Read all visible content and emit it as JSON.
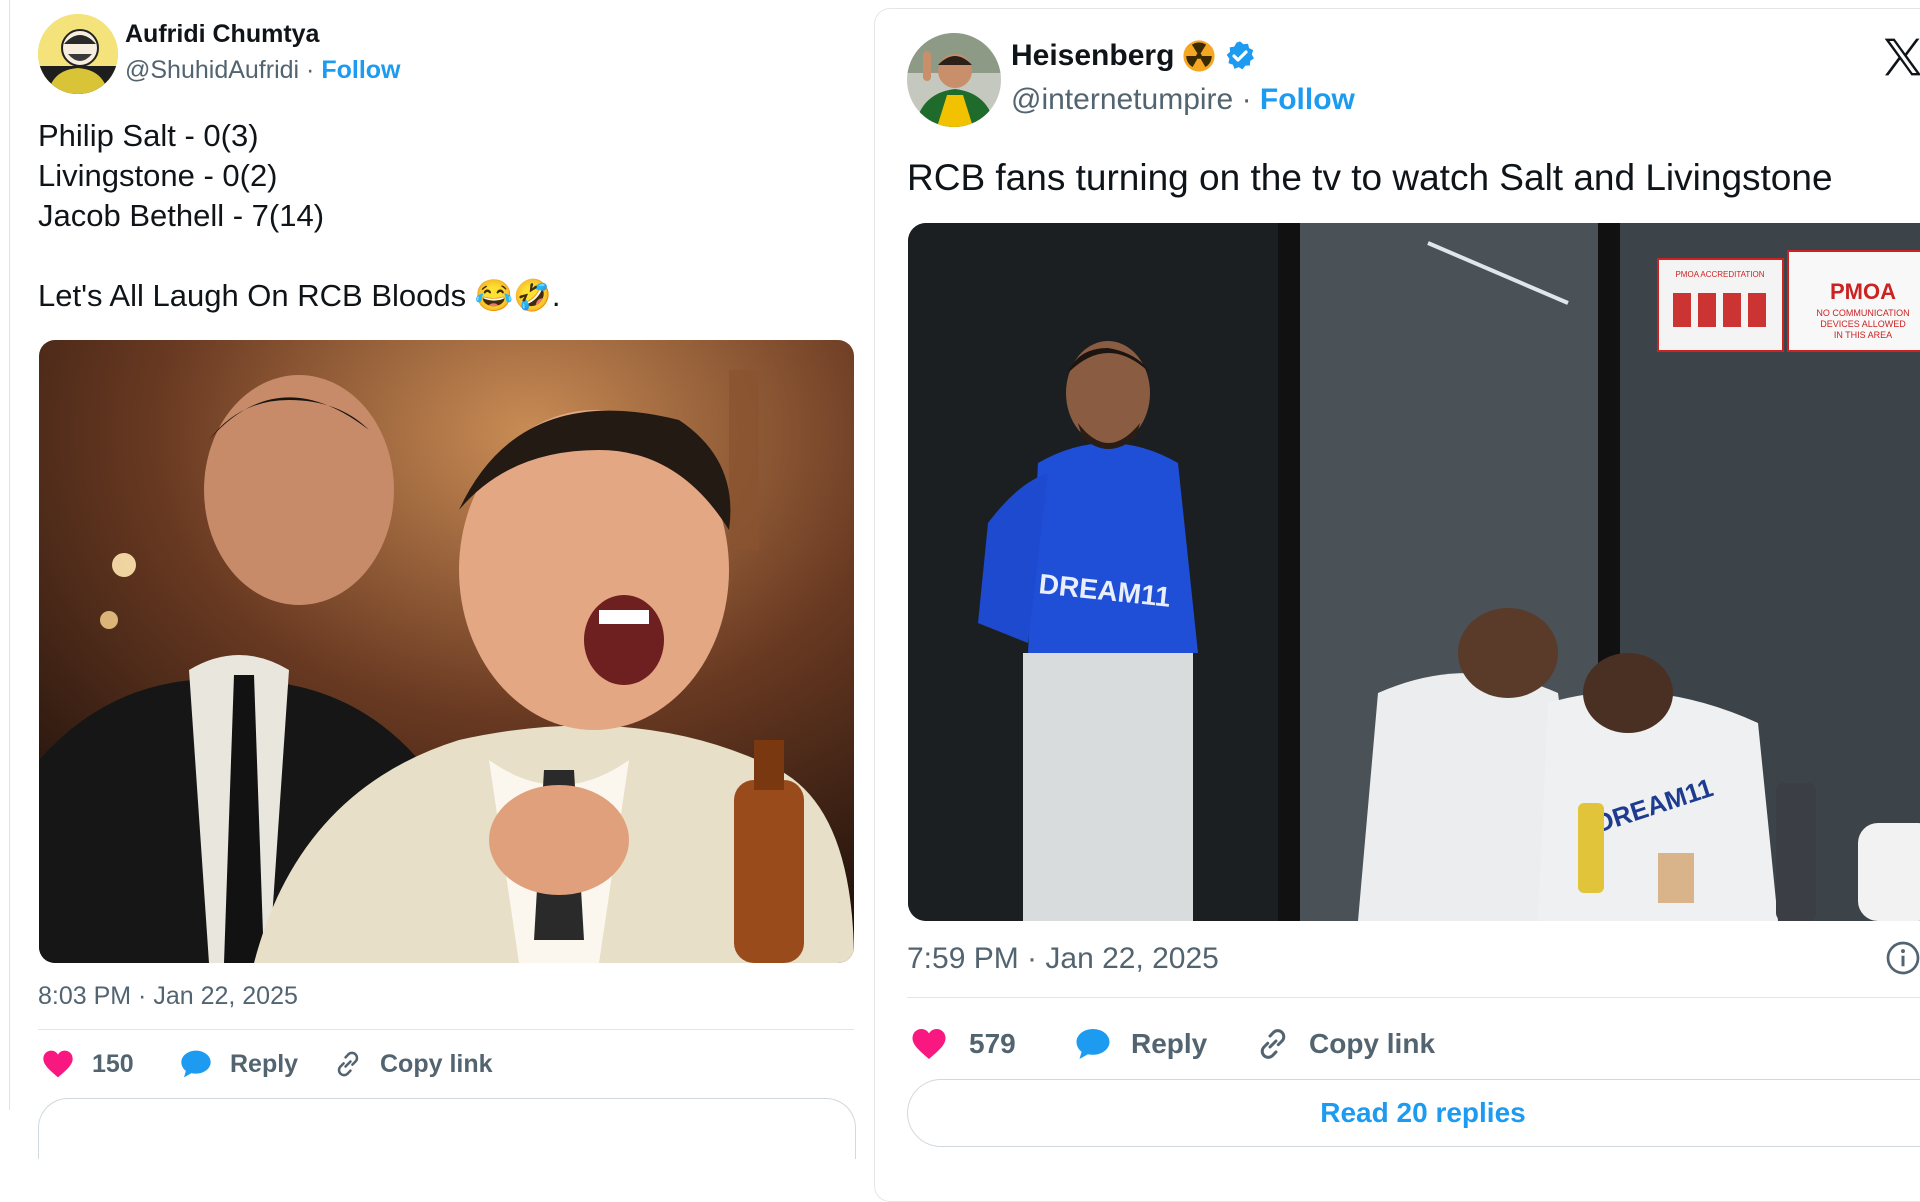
{
  "tweet_left": {
    "author_name": "Aufridi Chumtya",
    "handle": "@ShuhidAufridi",
    "separator": "·",
    "follow_label": "Follow",
    "text": "Philip Salt - 0(3)\nLivingstone - 0(2)\nJacob Bethell - 7(14)\n\nLet's All Laugh On RCB Bloods 😂🤣.",
    "timestamp": "8:03 PM · Jan 22, 2025",
    "like_count": "150",
    "reply_label": "Reply",
    "copy_link_label": "Copy link"
  },
  "tweet_right": {
    "author_name": "Heisenberg",
    "handle": "@internetumpire",
    "separator": "·",
    "follow_label": "Follow",
    "text": "RCB fans turning on the tv to watch Salt and Livingstone",
    "timestamp": "7:59 PM · Jan 22, 2025",
    "like_count": "579",
    "reply_label": "Reply",
    "copy_link_label": "Copy link",
    "read_replies_label": "Read 20 replies",
    "sign_text": {
      "heading": "PMOA",
      "lines": [
        "NO COMMUNICATION",
        "DEVICES ALLOWED",
        "IN THIS AREA"
      ],
      "left_sign": "PMOA ACCREDITATION"
    },
    "jersey_text": "DREAM11"
  },
  "colors": {
    "link_blue": "#1d9bf0",
    "like_pink": "#f91880",
    "muted_gray": "#536471",
    "verified_blue": "#1d9bf0"
  },
  "icons": [
    "heart-icon",
    "reply-bubble-icon",
    "link-icon",
    "verified-badge-icon",
    "radioactive-icon",
    "x-logo-icon",
    "info-icon"
  ]
}
